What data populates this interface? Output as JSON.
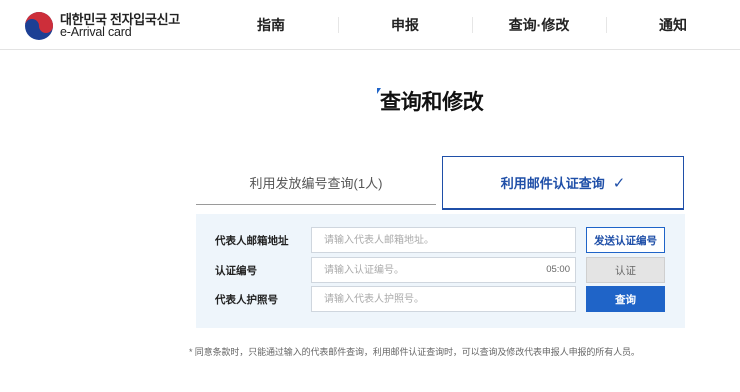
{
  "header": {
    "logo_line1": "대한민국 전자입국신고",
    "logo_line2": "e-Arrival card",
    "nav": [
      "指南",
      "申报",
      "查询·修改",
      "通知"
    ]
  },
  "page": {
    "title": "查询和修改"
  },
  "tabs": {
    "inactive_label": "利用发放编号查询(1人)",
    "active_label": "利用邮件认证查询",
    "active_check": "✓"
  },
  "form": {
    "email": {
      "label": "代表人邮箱地址",
      "placeholder": "请输入代表人邮箱地址。",
      "button": "发送认证编号"
    },
    "code": {
      "label": "认证编号",
      "placeholder": "请输入认证编号。",
      "timer": "05:00",
      "button": "认证"
    },
    "passport": {
      "label": "代表人护照号",
      "placeholder": "请输入代表人护照号。",
      "button": "查询"
    }
  },
  "note": "* 同意条款时，只能通过输入的代表邮件查询，利用邮件认证查询时，可以查询及修改代表申报人申报的所有人员。",
  "colors": {
    "accent": "#1f64c8",
    "panel_bg": "#eef5fb"
  }
}
